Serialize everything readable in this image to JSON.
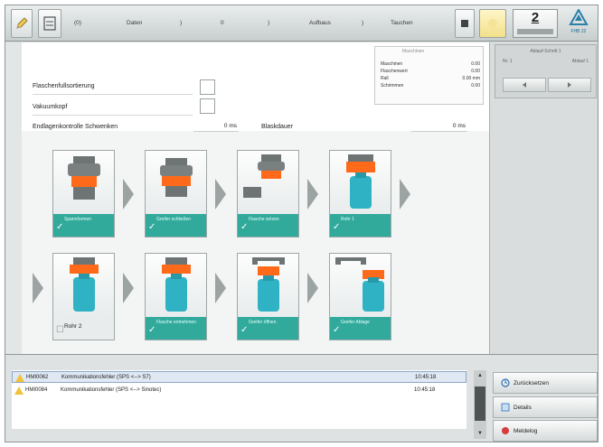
{
  "toolbar": {
    "crumbs": [
      "(0)",
      "Daten",
      ")",
      "0",
      ")",
      "Aufbaus",
      ")",
      "Tauchen"
    ],
    "mode_number": "2",
    "logo_text": "FHB 22"
  },
  "counter": {
    "title": "Ablauf-Schritt 1",
    "left_label": "Nr. 1",
    "right_label": "Ablauf 1"
  },
  "params": {
    "fields": [
      {
        "label": "Flaschenfullsortierung"
      },
      {
        "label": "Vakuumkopf"
      },
      {
        "label": "Endlagenkontrolle Schwenken",
        "value": "0 ms"
      },
      {
        "label": "Blaskdauer",
        "value": "0 ms"
      }
    ]
  },
  "info": {
    "title": "Maschinen",
    "rows": [
      {
        "label": "Maschinen",
        "value": "0.00"
      },
      {
        "label": "Flaschenwert",
        "value": "0.00"
      },
      {
        "label": "Rall",
        "value": "0.00 mm"
      },
      {
        "label": "Schrimmen",
        "value": "0.00"
      }
    ]
  },
  "steps": [
    {
      "caption": "Spannformen"
    },
    {
      "caption": "Greifer schließen"
    },
    {
      "caption": "Flasche setzen"
    },
    {
      "caption": "Rohr 1"
    },
    {
      "caption": "Rohr 2"
    },
    {
      "caption": "Flasche entnehmen"
    },
    {
      "caption": "Greifer öffnen"
    },
    {
      "caption": "Greifer Ablage"
    }
  ],
  "messages": [
    {
      "id": "HMI0062",
      "text": "Kommunikationsfehler (SPS <--> S7)",
      "time": "10:45:18"
    },
    {
      "id": "HMI0084",
      "text": "Kommunikationsfehler (SPS <--> Sinotec)",
      "time": "10:45:18"
    }
  ],
  "side_buttons": {
    "reset": "Zurücksetzen",
    "details": "Details",
    "log": "Meldelog"
  },
  "colors": {
    "accent": "#31aa9c",
    "toolbar": "#d7dada",
    "warning": "#f0c23b",
    "part_orange": "#ff6a1a"
  }
}
